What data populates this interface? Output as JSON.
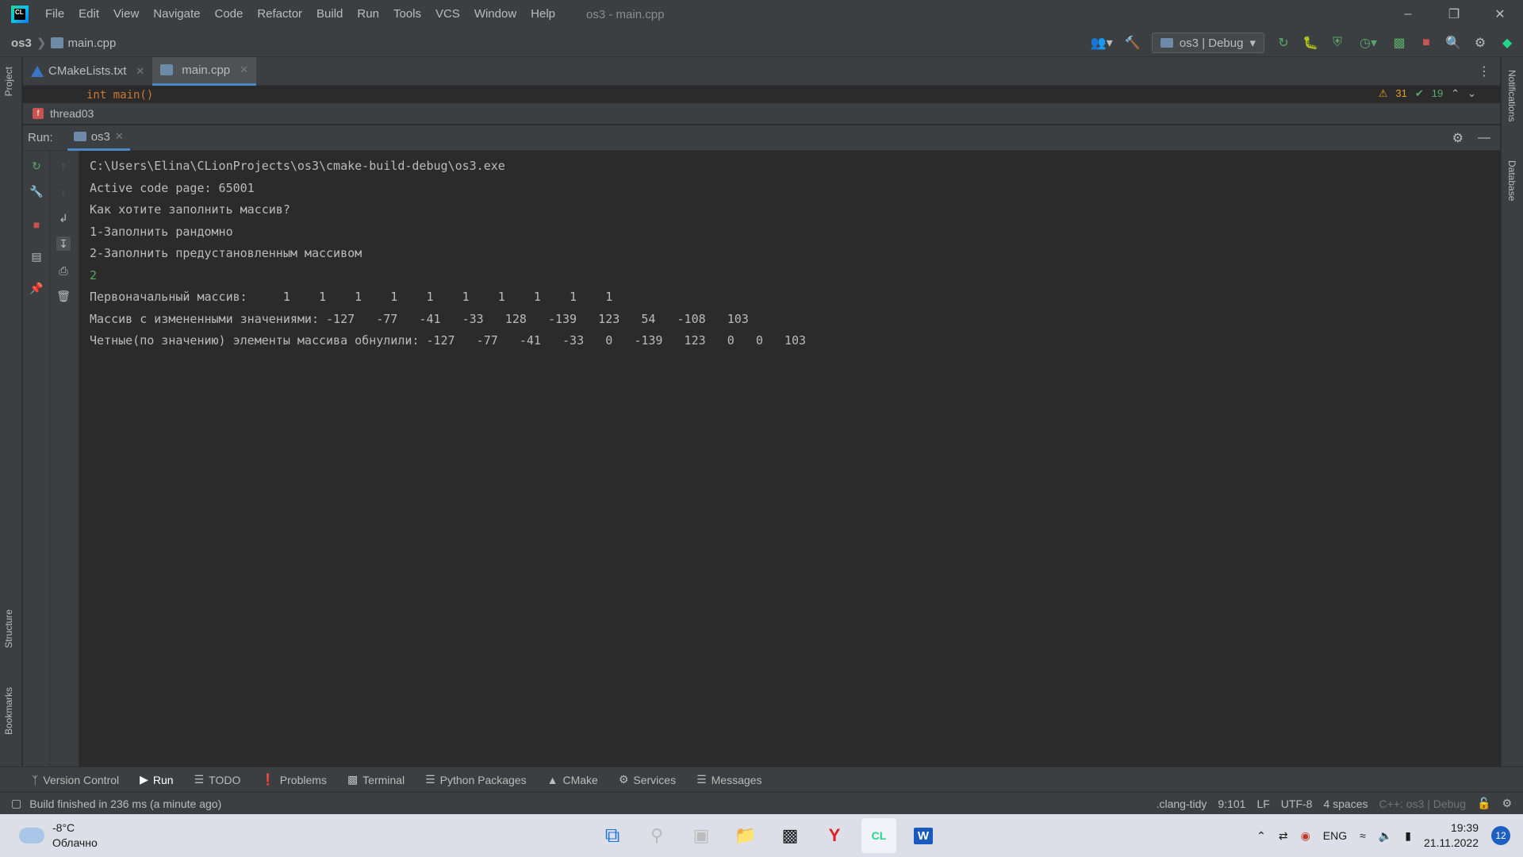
{
  "titlebar": {
    "menu": [
      {
        "label": "File"
      },
      {
        "label": "Edit"
      },
      {
        "label": "View"
      },
      {
        "label": "Navigate"
      },
      {
        "label": "Code"
      },
      {
        "label": "Refactor"
      },
      {
        "label": "Build"
      },
      {
        "label": "Run"
      },
      {
        "label": "Tools"
      },
      {
        "label": "VCS"
      },
      {
        "label": "Window"
      },
      {
        "label": "Help"
      }
    ],
    "window_title": "os3 - main.cpp"
  },
  "navbar": {
    "project": "os3",
    "file": "main.cpp",
    "run_config": "os3 | Debug"
  },
  "editor": {
    "tabs": [
      {
        "label": "CMakeLists.txt",
        "active": false
      },
      {
        "label": "main.cpp",
        "active": true
      }
    ],
    "code_peek": "int main()",
    "warnings": "31",
    "passes": "19",
    "function_crumb": "thread03"
  },
  "left_stripe": {
    "project": "Project",
    "structure": "Structure",
    "bookmarks": "Bookmarks"
  },
  "right_stripe": {
    "notifications": "Notifications",
    "database": "Database"
  },
  "run_panel": {
    "label": "Run:",
    "tab": "os3",
    "console_lines": [
      "C:\\Users\\Elina\\CLionProjects\\os3\\cmake-build-debug\\os3.exe",
      "Active code page: 65001",
      "Как хотите заполнить массив?",
      "1-Заполнить рандомно",
      "2-Заполнить предустановленным массивом",
      "2",
      "Первоначальный массив:     1    1    1    1    1    1    1    1    1    1",
      "Массив с измененными значениями: -127   -77   -41   -33   128   -139   123   54   -108   103",
      "Четные(по значению) элементы массива обнулили: -127   -77   -41   -33   0   -139   123   0   0   103"
    ]
  },
  "tool_windows": [
    {
      "label": "Version Control",
      "icon": "branch-icon"
    },
    {
      "label": "Run",
      "icon": "play-icon"
    },
    {
      "label": "TODO",
      "icon": "list-icon"
    },
    {
      "label": "Problems",
      "icon": "problems-icon"
    },
    {
      "label": "Terminal",
      "icon": "terminal-icon"
    },
    {
      "label": "Python Packages",
      "icon": "layers-icon"
    },
    {
      "label": "CMake",
      "icon": "cmake-icon"
    },
    {
      "label": "Services",
      "icon": "services-icon"
    },
    {
      "label": "Messages",
      "icon": "messages-icon"
    }
  ],
  "status_bar": {
    "message": "Build finished in 236 ms (a minute ago)",
    "linter": ".clang-tidy",
    "position": "9:101",
    "line_sep": "LF",
    "encoding": "UTF-8",
    "indent": "4 spaces",
    "context": "C++: os3 | Debug"
  },
  "taskbar": {
    "temperature": "-8°C",
    "weather": "Облачно",
    "language": "ENG",
    "time": "19:39",
    "date": "21.11.2022",
    "notifications": "12"
  }
}
